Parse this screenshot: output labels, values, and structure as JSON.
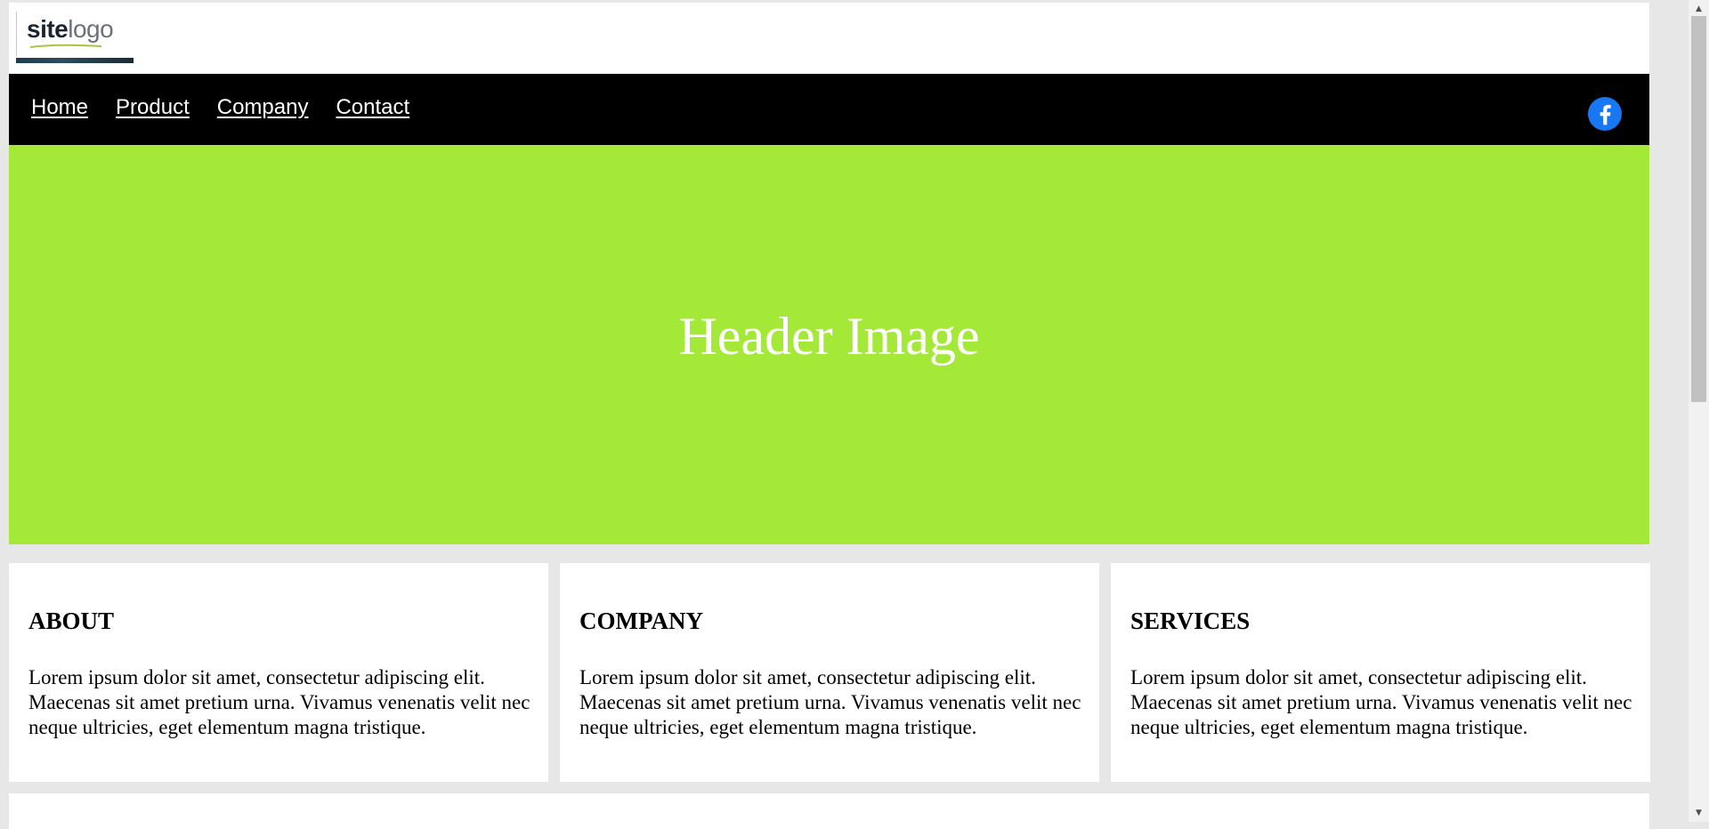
{
  "logo": {
    "text_bold": "site",
    "text_light": "logo"
  },
  "nav": {
    "items": [
      {
        "label": "Home"
      },
      {
        "label": "Product"
      },
      {
        "label": "Company"
      },
      {
        "label": "Contact"
      }
    ],
    "social_icon": "facebook-icon"
  },
  "hero": {
    "title": "Header Image",
    "background_color": "#a4e937"
  },
  "cards": [
    {
      "title": "ABOUT",
      "body": "Lorem ipsum dolor sit amet, consectetur adipiscing elit. Maecenas sit amet pretium urna. Vivamus venenatis velit nec neque ultricies, eget elementum magna tristique."
    },
    {
      "title": "COMPANY",
      "body": "Lorem ipsum dolor sit amet, consectetur adipiscing elit. Maecenas sit amet pretium urna. Vivamus venenatis velit nec neque ultricies, eget elementum magna tristique."
    },
    {
      "title": "SERVICES",
      "body": "Lorem ipsum dolor sit amet, consectetur adipiscing elit. Maecenas sit amet pretium urna. Vivamus venenatis velit nec neque ultricies, eget elementum magna tristique."
    }
  ],
  "colors": {
    "page_background": "#e8e7e8",
    "nav_background": "#000000",
    "facebook_blue": "#1877f2"
  }
}
